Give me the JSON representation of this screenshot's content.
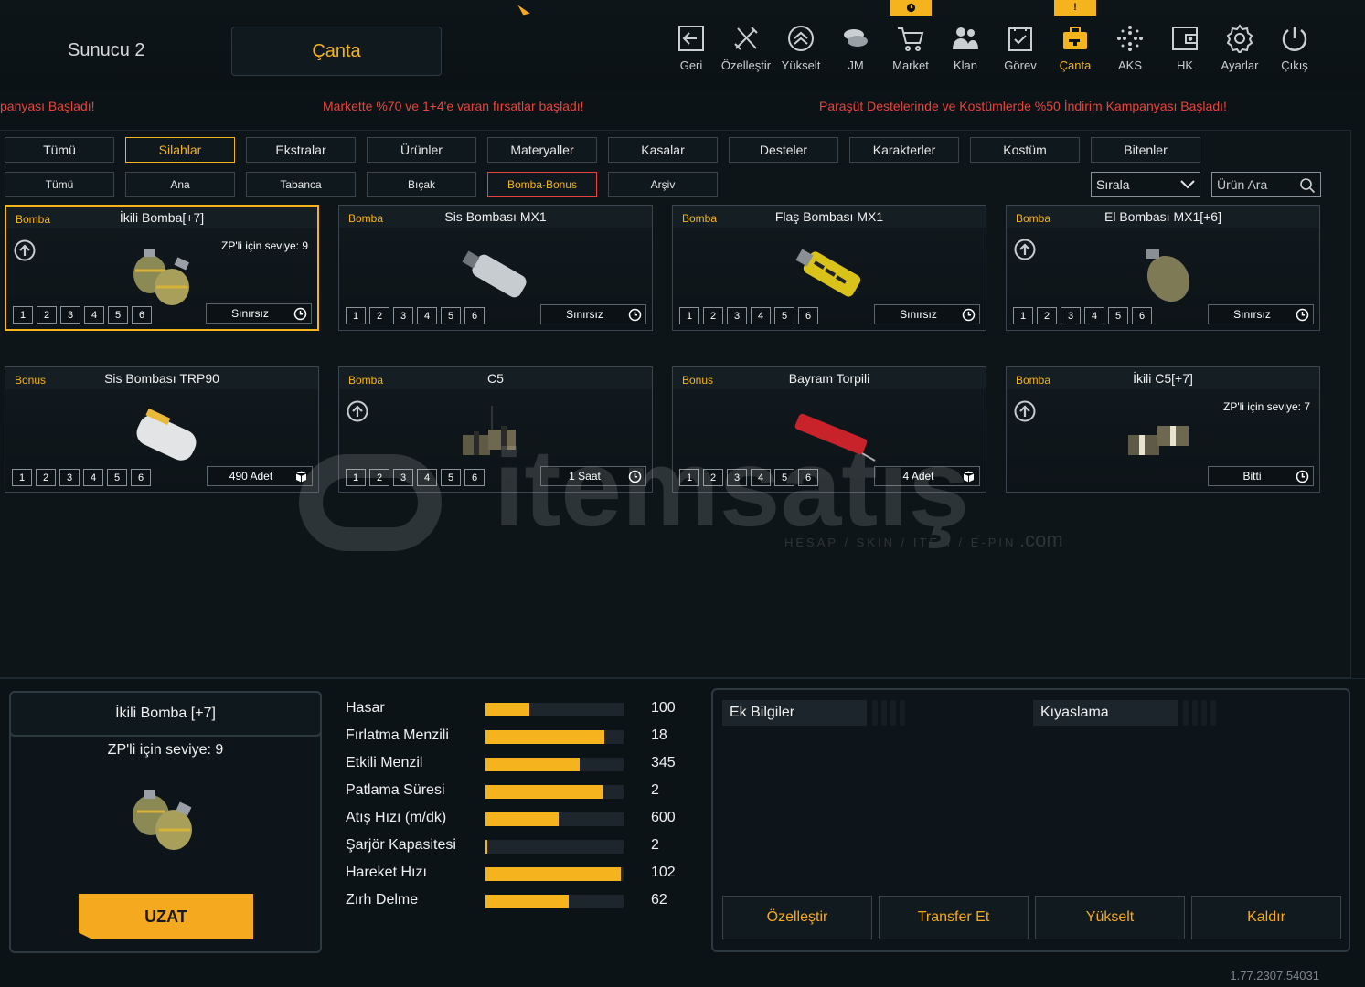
{
  "header": {
    "server": "Sunucu 2",
    "page_title": "Çanta",
    "nav": [
      {
        "label": "Geri",
        "icon": "exit-icon"
      },
      {
        "label": "Özelleştir",
        "icon": "tools-icon"
      },
      {
        "label": "Yükselt",
        "icon": "upgrade-icon"
      },
      {
        "label": "JM",
        "icon": "coins-icon"
      },
      {
        "label": "Market",
        "icon": "cart-icon",
        "badge": "clock"
      },
      {
        "label": "Klan",
        "icon": "clan-icon"
      },
      {
        "label": "Görev",
        "icon": "task-icon"
      },
      {
        "label": "Çanta",
        "icon": "bag-icon",
        "badge": "!",
        "active": true
      },
      {
        "label": "AKS",
        "icon": "aks-icon"
      },
      {
        "label": "HK",
        "icon": "wallet-icon"
      },
      {
        "label": "Ayarlar",
        "icon": "gear-icon"
      },
      {
        "label": "Çıkış",
        "icon": "power-icon"
      }
    ]
  },
  "ticker": [
    "panyası Başladı!",
    "Markette %70 ve 1+4'e varan fırsatlar başladı!",
    "Paraşüt Destelerinde ve Kostümlerde %50 İndirim Kampanyası Başladı!"
  ],
  "tabs": [
    "Tümü",
    "Silahlar",
    "Ekstralar",
    "Ürünler",
    "Materyaller",
    "Kasalar",
    "Desteler",
    "Karakterler",
    "Kostüm",
    "Bitenler"
  ],
  "active_tab": "Silahlar",
  "subtabs": [
    "Tümü",
    "Ana",
    "Tabanca",
    "Bıçak",
    "Bomba-Bonus",
    "Arşiv"
  ],
  "active_subtab": "Bomba-Bonus",
  "sort": {
    "label": "Sırala"
  },
  "search": {
    "placeholder": "Ürün Ara"
  },
  "items": [
    {
      "type": "Bomba",
      "name": "İkili Bomba[+7]",
      "level_text": "ZP'li için seviye: 9",
      "upgrade": true,
      "levels": [
        "1",
        "2",
        "3",
        "4",
        "5",
        "6"
      ],
      "duration": "Sınırsız",
      "duration_icon": "clock-icon",
      "image": "double-grenade",
      "selected": true
    },
    {
      "type": "Bomba",
      "name": "Sis Bombası MX1",
      "level_text": "",
      "upgrade": false,
      "levels": [
        "1",
        "2",
        "3",
        "4",
        "5",
        "6"
      ],
      "duration": "Sınırsız",
      "duration_icon": "clock-icon",
      "image": "smoke-grenade"
    },
    {
      "type": "Bomba",
      "name": "Flaş Bombası MX1",
      "level_text": "",
      "upgrade": false,
      "levels": [
        "1",
        "2",
        "3",
        "4",
        "5",
        "6"
      ],
      "duration": "Sınırsız",
      "duration_icon": "clock-icon",
      "image": "flash-grenade"
    },
    {
      "type": "Bomba",
      "name": "El Bombası MX1[+6]",
      "level_text": "",
      "upgrade": true,
      "levels": [
        "1",
        "2",
        "3",
        "4",
        "5",
        "6"
      ],
      "duration": "Sınırsız",
      "duration_icon": "clock-icon",
      "image": "frag-grenade"
    },
    {
      "type": "Bonus",
      "name": "Sis Bombası TRP90",
      "level_text": "",
      "upgrade": false,
      "levels": [
        "1",
        "2",
        "3",
        "4",
        "5",
        "6"
      ],
      "duration": "490 Adet",
      "duration_icon": "box-icon",
      "image": "trp90-grenade"
    },
    {
      "type": "Bomba",
      "name": "C5",
      "level_text": "",
      "upgrade": true,
      "levels": [
        "1",
        "2",
        "3",
        "4",
        "5",
        "6"
      ],
      "duration": "1 Saat",
      "duration_icon": "clock-icon",
      "image": "c5-charge"
    },
    {
      "type": "Bonus",
      "name": "Bayram Torpili",
      "level_text": "",
      "upgrade": false,
      "levels": [
        "1",
        "2",
        "3",
        "4",
        "5",
        "6"
      ],
      "duration": "4 Adet",
      "duration_icon": "box-icon",
      "image": "firecracker"
    },
    {
      "type": "Bomba",
      "name": "İkili C5[+7]",
      "level_text": "ZP'li için seviye: 7",
      "upgrade": true,
      "levels": [],
      "duration": "Bitti",
      "duration_icon": "clock-icon",
      "image": "double-c5"
    }
  ],
  "watermark": {
    "brand": "itemsatış",
    "tagline": "HESAP / SKIN / ITEM / E-PIN",
    "suffix": ".com"
  },
  "detail": {
    "title": "İkili Bomba [+7]",
    "level_text": "ZP'li için seviye: 9",
    "extend_button": "UZAT"
  },
  "stats": [
    {
      "label": "Hasar",
      "value": "100",
      "fill": 0.32
    },
    {
      "label": "Fırlatma Menzili",
      "value": "18",
      "fill": 0.86
    },
    {
      "label": "Etkili Menzil",
      "value": "345",
      "fill": 0.68
    },
    {
      "label": "Patlama Süresi",
      "value": "2",
      "fill": 0.85
    },
    {
      "label": "Atış Hızı (m/dk)",
      "value": "600",
      "fill": 0.53
    },
    {
      "label": "Şarjör Kapasitesi",
      "value": "2",
      "fill": 0.01
    },
    {
      "label": "Hareket Hızı",
      "value": "102",
      "fill": 0.98
    },
    {
      "label": "Zırh Delme",
      "value": "62",
      "fill": 0.6
    }
  ],
  "info": {
    "extra": "Ek Bilgiler",
    "compare": "Kıyaslama"
  },
  "actions": [
    "Özelleştir",
    "Transfer Et",
    "Yükselt",
    "Kaldır"
  ],
  "version": "1.77.2307.54031",
  "colors": {
    "accent": "#f5b31e",
    "alert": "#e8443a",
    "background": "#0c1317"
  }
}
